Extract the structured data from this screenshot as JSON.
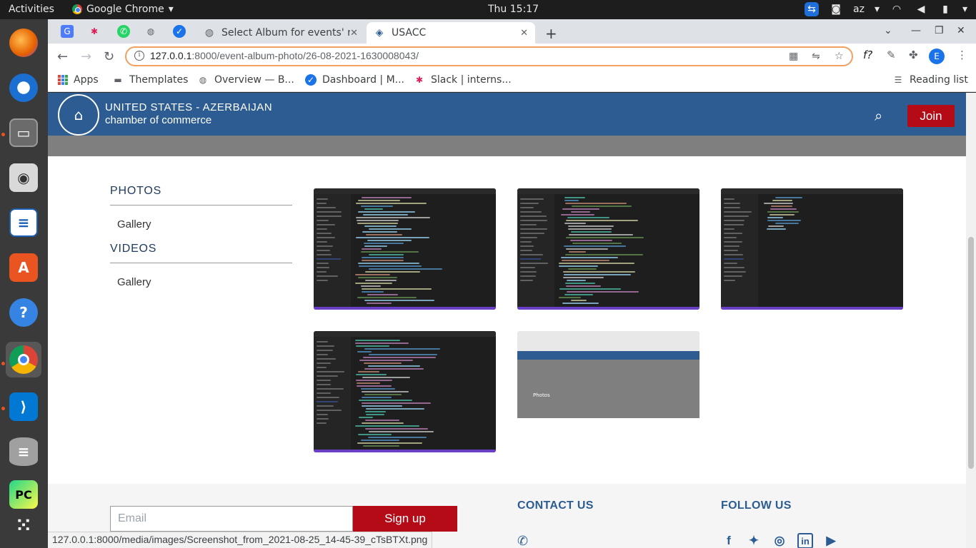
{
  "topbar": {
    "activities": "Activities",
    "app_name": "Google Chrome",
    "clock": "Thu 15:17",
    "keyboard": "az"
  },
  "browser": {
    "tabs": [
      {
        "label": "Select Album for events' n"
      },
      {
        "label": "USACC"
      }
    ],
    "address": {
      "host": "127.0.0.1",
      "path": ":8000/event-album-photo/26-08-2021-1630008043/"
    },
    "profile_initial": "E",
    "bookmarks": [
      {
        "label": "Apps"
      },
      {
        "label": "Themplates"
      },
      {
        "label": "Overview — B..."
      },
      {
        "label": "Dashboard | M..."
      },
      {
        "label": "Slack | interns..."
      }
    ],
    "reading_list": "Reading list",
    "status_url": "127.0.0.1:8000/media/images/Screenshot_from_2021-08-25_14-45-39_cTsBTXt.png"
  },
  "site": {
    "logo_line1": "UNITED STATES - AZERBAIJAN",
    "logo_line2": "chamber of commerce",
    "join": "Join",
    "sidebar": {
      "photos_heading": "PHOTOS",
      "photos_link": "Gallery",
      "videos_heading": "VIDEOS",
      "videos_link": "Gallery"
    },
    "thumb_web_title": "Photos",
    "footer": {
      "email_placeholder": "Email",
      "signup": "Sign up",
      "contact": "CONTACT US",
      "follow": "FOLLOW US"
    }
  },
  "colors": {
    "brand_blue": "#2c5c91",
    "brand_red": "#b50b17",
    "hero_gray": "#7f7f7f"
  }
}
